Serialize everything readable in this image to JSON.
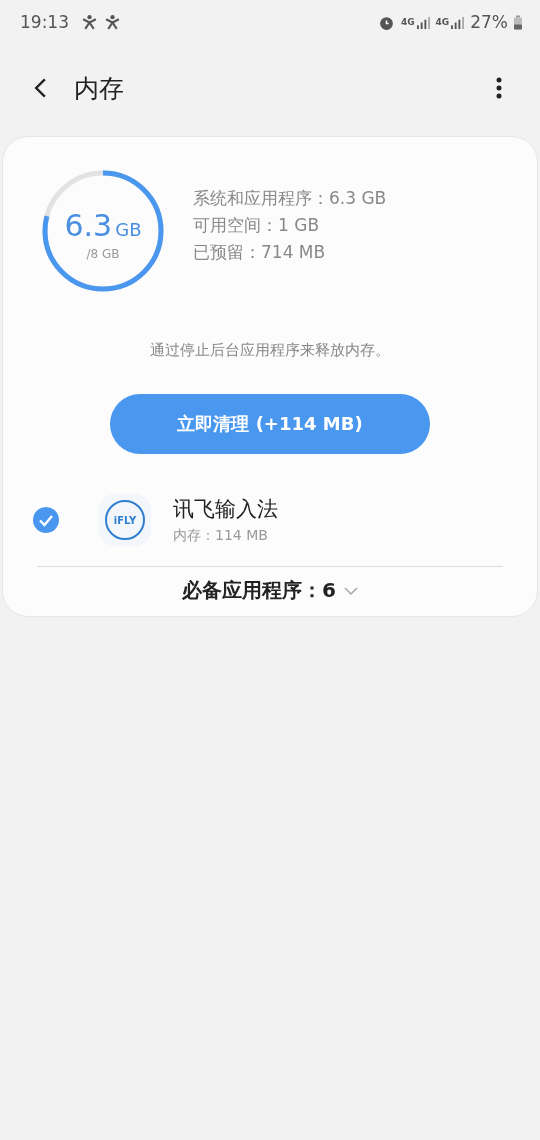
{
  "status_bar": {
    "time": "19:13",
    "network_labels": [
      "4G",
      "4G"
    ],
    "battery": "27%"
  },
  "header": {
    "title": "内存"
  },
  "summary": {
    "used": "6.3",
    "used_unit": "GB",
    "total": "/8 GB",
    "level": 0.79,
    "details": [
      "系统和应用程序：6.3 GB",
      "可用空间：1 GB",
      "已预留：714 MB"
    ]
  },
  "hint": "通过停止后台应用程序来释放内存。",
  "clean_button": "立即清理 (+114 MB)",
  "apps": [
    {
      "name": "讯飞输入法",
      "memory": "内存：114 MB",
      "icon_text": "iFLY",
      "checked": true
    }
  ],
  "essential": {
    "label": "必备应用程序：6",
    "expanded": false
  }
}
